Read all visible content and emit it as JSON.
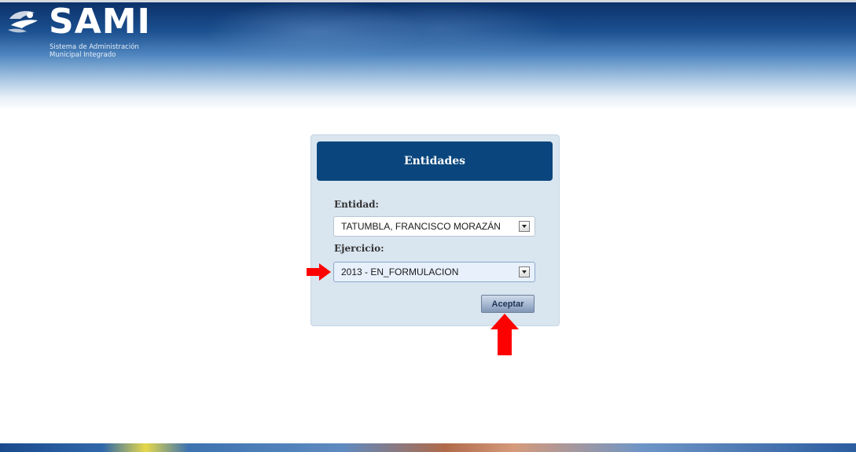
{
  "header": {
    "logo_name": "SAMI",
    "logo_subtitle_line1": "Sistema de Administración",
    "logo_subtitle_line2": "Municipal Integrado"
  },
  "panel": {
    "title": "Entidades",
    "entidad_label": "Entidad:",
    "entidad_value": "TATUMBLA, FRANCISCO MORAZÁN",
    "ejercicio_label": "Ejercicio:",
    "ejercicio_value": "2013 - EN_FORMULACION",
    "accept_label": "Aceptar"
  },
  "annotations": {
    "arrow_color": "#ff0000"
  },
  "colors": {
    "panel_header": "#0a467d",
    "panel_background": "#d9e5ef"
  }
}
